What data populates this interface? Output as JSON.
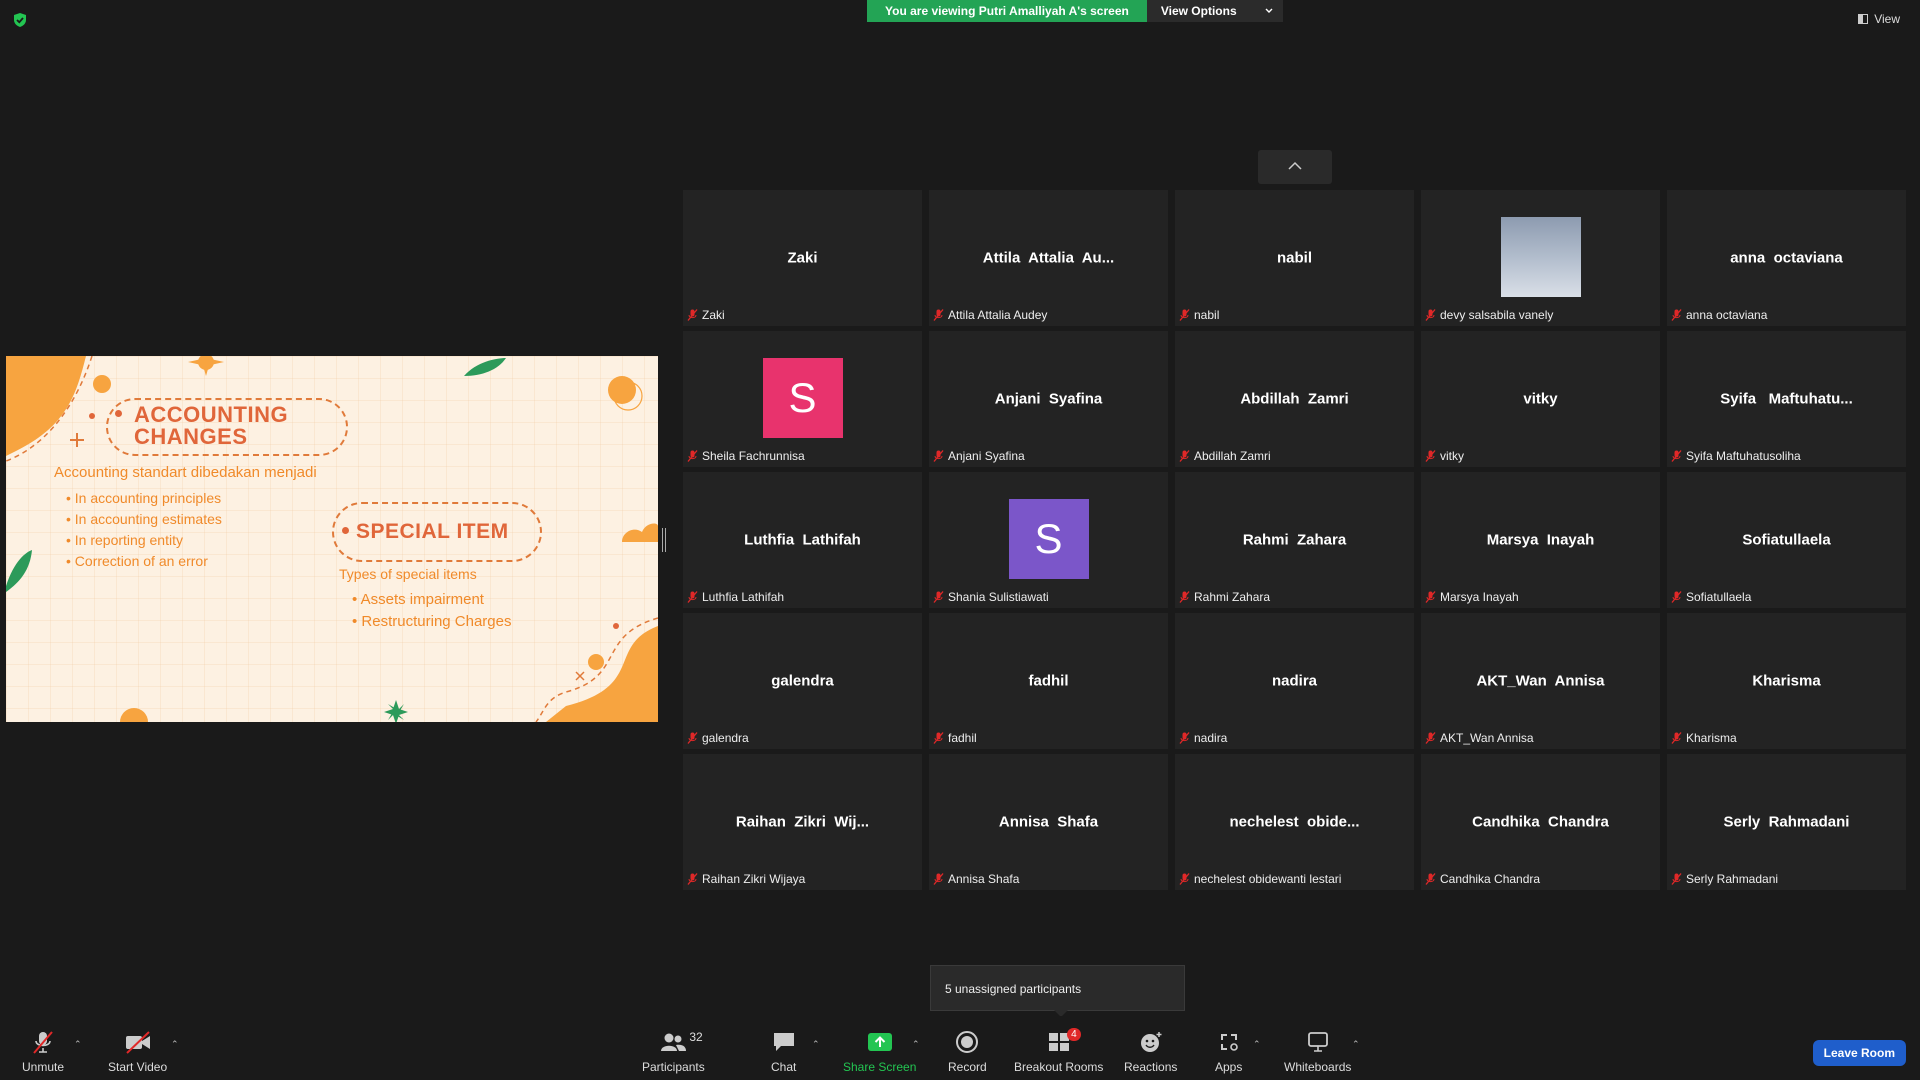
{
  "banner": {
    "viewing": "You are viewing Putri Amalliyah A's screen",
    "options": "View Options"
  },
  "view_label": "View",
  "slide": {
    "title1_line1": "ACCOUNTING",
    "title1_line2": "CHANGES",
    "subtitle": "Accounting standart dibedakan menjadi",
    "list1": [
      "In accounting principles",
      "In accounting estimates",
      "In reporting entity",
      "Correction of an error"
    ],
    "title2": "SPECIAL ITEM",
    "subtitle2": "Types of special items",
    "list2": [
      "Assets impairment",
      "Restructuring Charges"
    ]
  },
  "tiles": [
    {
      "big": "Zaki",
      "name": "Zaki"
    },
    {
      "big": "Attila  Attalia  Au...",
      "name": "Attila Attalia Audey"
    },
    {
      "big": "nabil",
      "name": "nabil"
    },
    {
      "big": "",
      "name": "devy salsabila vanely"
    },
    {
      "big": "anna  octaviana",
      "name": "anna octaviana"
    },
    {
      "big": "",
      "name": "Sheila Fachrunnisa",
      "letter": "S"
    },
    {
      "big": "Anjani  Syafina",
      "name": "Anjani Syafina"
    },
    {
      "big": "Abdillah  Zamri",
      "name": "Abdillah Zamri"
    },
    {
      "big": "vitky",
      "name": "vitky"
    },
    {
      "big": "Syifa   Maftuhatu...",
      "name": "Syifa Maftuhatusoliha"
    },
    {
      "big": "Luthfia  Lathifah",
      "name": "Luthfia Lathifah"
    },
    {
      "big": "",
      "name": "Shania Sulistiawati",
      "letter": "S"
    },
    {
      "big": "Rahmi  Zahara",
      "name": "Rahmi Zahara"
    },
    {
      "big": "Marsya  Inayah",
      "name": "Marsya Inayah"
    },
    {
      "big": "Sofiatullaela",
      "name": "Sofiatullaela"
    },
    {
      "big": "galendra",
      "name": "galendra"
    },
    {
      "big": "fadhil",
      "name": "fadhil"
    },
    {
      "big": "nadira",
      "name": "nadira"
    },
    {
      "big": "AKT_Wan  Annisa",
      "name": "AKT_Wan Annisa"
    },
    {
      "big": "Kharisma",
      "name": "Kharisma"
    },
    {
      "big": "Raihan  Zikri  Wij...",
      "name": "Raihan Zikri Wijaya"
    },
    {
      "big": "Annisa  Shafa",
      "name": "Annisa Shafa"
    },
    {
      "big": "nechelest  obide...",
      "name": "nechelest obidewanti lestari"
    },
    {
      "big": "Candhika  Chandra",
      "name": "Candhika Chandra"
    },
    {
      "big": "Serly  Rahmadani",
      "name": "Serly Rahmadani"
    }
  ],
  "colors": {
    "avatar_sheila": "#e8336d",
    "avatar_shania": "#7b56c9",
    "share_green": "#23c552"
  },
  "unassigned": "5 unassigned participants",
  "toolbar": {
    "unmute": "Unmute",
    "start_video": "Start Video",
    "participants": "Participants",
    "participants_count": "32",
    "chat": "Chat",
    "share_screen": "Share Screen",
    "record": "Record",
    "breakout": "Breakout Rooms",
    "breakout_badge": "4",
    "reactions": "Reactions",
    "apps": "Apps",
    "whiteboards": "Whiteboards",
    "leave": "Leave Room"
  }
}
